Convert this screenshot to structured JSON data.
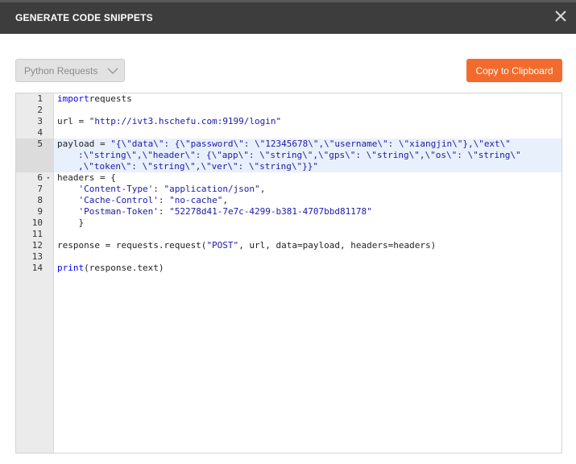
{
  "dialog": {
    "title": "GENERATE CODE SNIPPETS",
    "close_icon": "close-icon"
  },
  "toolbar": {
    "language_selected": "Python Requests",
    "copy_label": "Copy to Clipboard",
    "accent_color": "#f26b2c"
  },
  "editor": {
    "active_line": 5,
    "lines": [
      {
        "num": "1",
        "p": [
          [
            "kw",
            "import"
          ],
          [
            "",
            "requests"
          ]
        ]
      },
      {
        "num": "2"
      },
      {
        "num": "3",
        "p": [
          [
            "",
            "url = "
          ],
          [
            "st",
            "\"http://ivt3.hschefu.com:9199/login\""
          ]
        ]
      },
      {
        "num": "4"
      },
      {
        "num": "5",
        "p": [
          [
            "",
            "payload = "
          ],
          [
            "st",
            "\"{\\\"data\\\": {\\\"password\\\": \\\"12345678\\\",\\\"username\\\": \\\"xiangjin\\\"},\\\"ext\\\""
          ]
        ]
      },
      {
        "num": "",
        "cont": true,
        "p": [
          [
            "st",
            ":\\\"string\\\",\\\"header\\\": {\\\"app\\\": \\\"string\\\",\\\"gps\\\": \\\"string\\\",\\\"os\\\": \\\"string\\\""
          ]
        ]
      },
      {
        "num": "",
        "cont": true,
        "p": [
          [
            "st",
            ",\\\"token\\\": \\\"string\\\",\\\"ver\\\": \\\"string\\\"}}\""
          ]
        ]
      },
      {
        "num": "6",
        "fold": true,
        "p": [
          [
            "",
            "headers = {"
          ]
        ]
      },
      {
        "num": "7",
        "p": [
          [
            "",
            "    "
          ],
          [
            "st",
            "'Content-Type'"
          ],
          [
            "",
            ": "
          ],
          [
            "st",
            "\"application/json\""
          ],
          [
            "",
            ","
          ]
        ]
      },
      {
        "num": "8",
        "p": [
          [
            "",
            "    "
          ],
          [
            "st",
            "'Cache-Control'"
          ],
          [
            "",
            ": "
          ],
          [
            "st",
            "\"no-cache\""
          ],
          [
            "",
            ","
          ]
        ]
      },
      {
        "num": "9",
        "p": [
          [
            "",
            "    "
          ],
          [
            "st",
            "'Postman-Token'"
          ],
          [
            "",
            ": "
          ],
          [
            "st",
            "\"52278d41-7e7c-4299-b381-4707bbd81178\""
          ]
        ]
      },
      {
        "num": "10",
        "p": [
          [
            "",
            "    }"
          ]
        ]
      },
      {
        "num": "11"
      },
      {
        "num": "12",
        "p": [
          [
            "",
            "response = requests.request("
          ],
          [
            "st",
            "\"POST\""
          ],
          [
            "",
            ", url, data=payload, headers=headers)"
          ]
        ]
      },
      {
        "num": "13"
      },
      {
        "num": "14",
        "p": [
          [
            "kw",
            "print"
          ],
          [
            "",
            "(response.text)"
          ]
        ]
      }
    ]
  }
}
